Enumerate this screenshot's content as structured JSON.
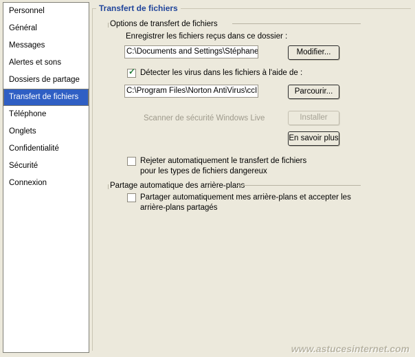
{
  "sidebar": {
    "items": [
      {
        "label": "Personnel",
        "selected": false
      },
      {
        "label": "Général",
        "selected": false
      },
      {
        "label": "Messages",
        "selected": false
      },
      {
        "label": "Alertes et sons",
        "selected": false
      },
      {
        "label": "Dossiers de partage",
        "selected": false
      },
      {
        "label": "Transfert de fichiers",
        "selected": true
      },
      {
        "label": "Téléphone",
        "selected": false
      },
      {
        "label": "Onglets",
        "selected": false
      },
      {
        "label": "Confidentialité",
        "selected": false
      },
      {
        "label": "Sécurité",
        "selected": false
      },
      {
        "label": "Connexion",
        "selected": false
      }
    ]
  },
  "panel": {
    "title": "Transfert de fichiers",
    "groups": {
      "transfer": {
        "legend": "Options de transfert de fichiers",
        "folder_label": "Enregistrer les fichiers reçus dans ce dossier :",
        "folder_value": "C:\\Documents and Settings\\Stéphane\\Mes do",
        "folder_button": "Modifier...",
        "virus_checkbox_label": "Détecter les virus dans les fichiers à l'aide de :",
        "virus_checkbox_checked": true,
        "virus_value": "C:\\Program Files\\Norton AntiVirus\\ccIMScan.e",
        "virus_button": "Parcourir...",
        "scanner_label": "Scanner de sécurité Windows Live",
        "scanner_label_disabled": true,
        "install_button": "Installer",
        "install_button_disabled": true,
        "learn_more_button": "En savoir plus",
        "reject_checkbox_line1": "Rejeter automatiquement le transfert de fichiers",
        "reject_checkbox_line2": "pour les types de fichiers dangereux",
        "reject_checkbox_checked": false
      },
      "backgrounds": {
        "legend": "Partage automatique des arrière-plans",
        "share_checkbox_line1": "Partager automatiquement mes arrière-plans et accepter les",
        "share_checkbox_line2": "arrière-plans partagés",
        "share_checkbox_checked": false
      }
    }
  },
  "watermark": {
    "text": "www.astucesinternet.com"
  },
  "colors": {
    "window_background": "#ece9dc",
    "selection_blue": "#2f5fc4",
    "title_blue": "#21459b",
    "check_green": "#1f7a35",
    "disabled_text": "#9e9a8c"
  }
}
